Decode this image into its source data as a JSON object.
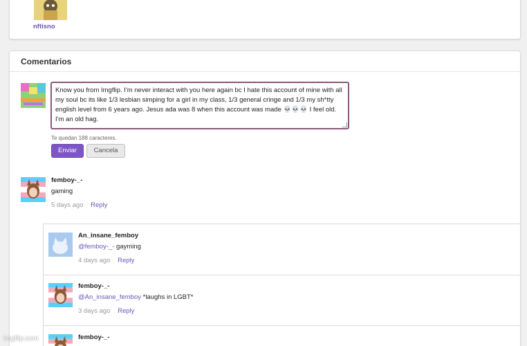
{
  "top_user": {
    "name": "nftisno"
  },
  "comments_section": {
    "title": "Comentarios",
    "composer": {
      "text": "Know you from Imgflip. I'm never interact with you here again bc I hate this account of mine with all my soul bc its like 1/3 lesbian simping for a girl in my class, 1/3 general cringe and 1/3 my sh*tty english level from 6 years ago. Jesus ada was 8 when this account was made 💀💀💀 I feel old. I'm an old hag.",
      "chars_left": "Te quedan 188 caracteres.",
      "send_label": "Enviar",
      "cancel_label": "Cancela"
    },
    "comments": [
      {
        "user": "femboy-_-",
        "text": "gaming",
        "time": "5 days ago",
        "reply_label": "Reply"
      }
    ],
    "replies": [
      {
        "user": "An_insane_femboy",
        "mention": "@femboy-_-",
        "text": " gayming",
        "time": "4 days ago",
        "reply_label": "Reply"
      },
      {
        "user": "femboy-_-",
        "mention": "@An_insane_femboy",
        "text": " *laughs in LGBT*",
        "time": "3 days ago",
        "reply_label": "Reply"
      },
      {
        "user": "femboy-_-",
        "mention": "",
        "text": "",
        "time": "",
        "reply_label": ""
      }
    ]
  },
  "watermark": "imgflip.com",
  "colors": {
    "accent": "#7d55c7",
    "link": "#6a55b4",
    "textarea_border": "#8a5775"
  }
}
